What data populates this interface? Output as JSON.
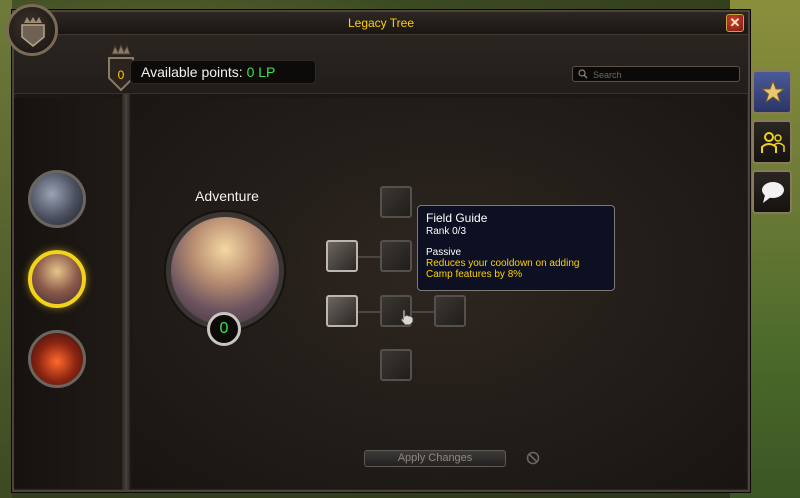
{
  "window": {
    "title": "Legacy Tree",
    "close_label": "✕"
  },
  "header": {
    "points_badge_value": "0",
    "available_label": "Available points: ",
    "available_value": "0 LP",
    "search_placeholder": "Search"
  },
  "sidebar": {
    "categories": [
      {
        "name": "category-1",
        "active": false
      },
      {
        "name": "Adventure",
        "active": true
      },
      {
        "name": "category-3",
        "active": false
      }
    ]
  },
  "tree": {
    "title": "Adventure",
    "points_spent": "0"
  },
  "tooltip": {
    "name": "Field Guide",
    "rank": "Rank 0/3",
    "type": "Passive",
    "description": "Reduces your cooldown on adding Camp features by 8%"
  },
  "footer": {
    "apply_label": "Apply Changes"
  },
  "colors": {
    "gold": "#ffd100",
    "green": "#41e04a",
    "active_ring": "#f2d21a"
  }
}
